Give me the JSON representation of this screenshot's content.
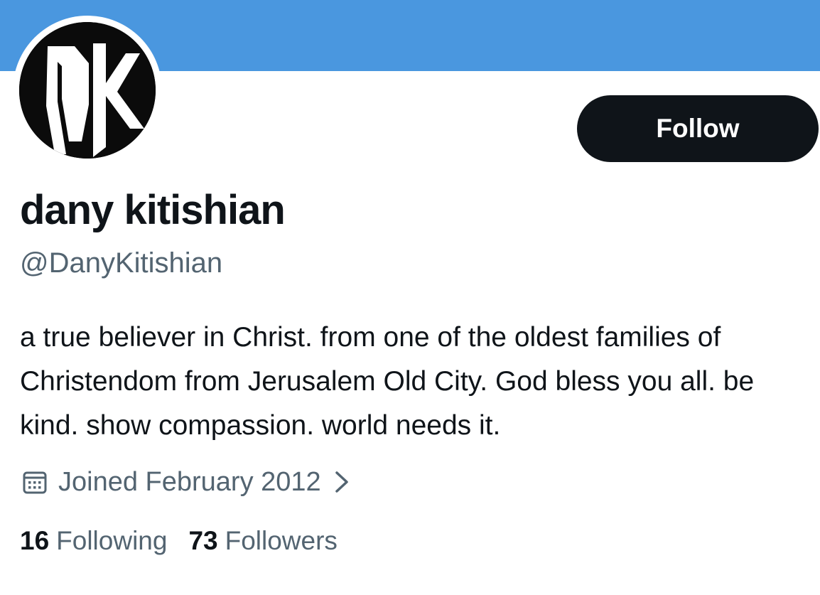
{
  "profile": {
    "display_name": "dany kitishian",
    "handle": "@DanyKitishian",
    "bio": "a true believer in Christ. from one of the oldest families of Christendom from Jerusalem Old City. God bless you all. be kind. show compassion. world needs it.",
    "joined": "Joined February 2012",
    "avatar_monogram": "DK"
  },
  "actions": {
    "follow_label": "Follow"
  },
  "stats": {
    "following_count": "16",
    "following_label": "Following",
    "followers_count": "73",
    "followers_label": "Followers"
  },
  "icons": {
    "joined": "calendar-icon",
    "joined_chevron": "chevron-right-icon"
  },
  "colors": {
    "banner": "#4a97df",
    "follow_button": "#0f1419",
    "secondary_text": "#536471"
  }
}
